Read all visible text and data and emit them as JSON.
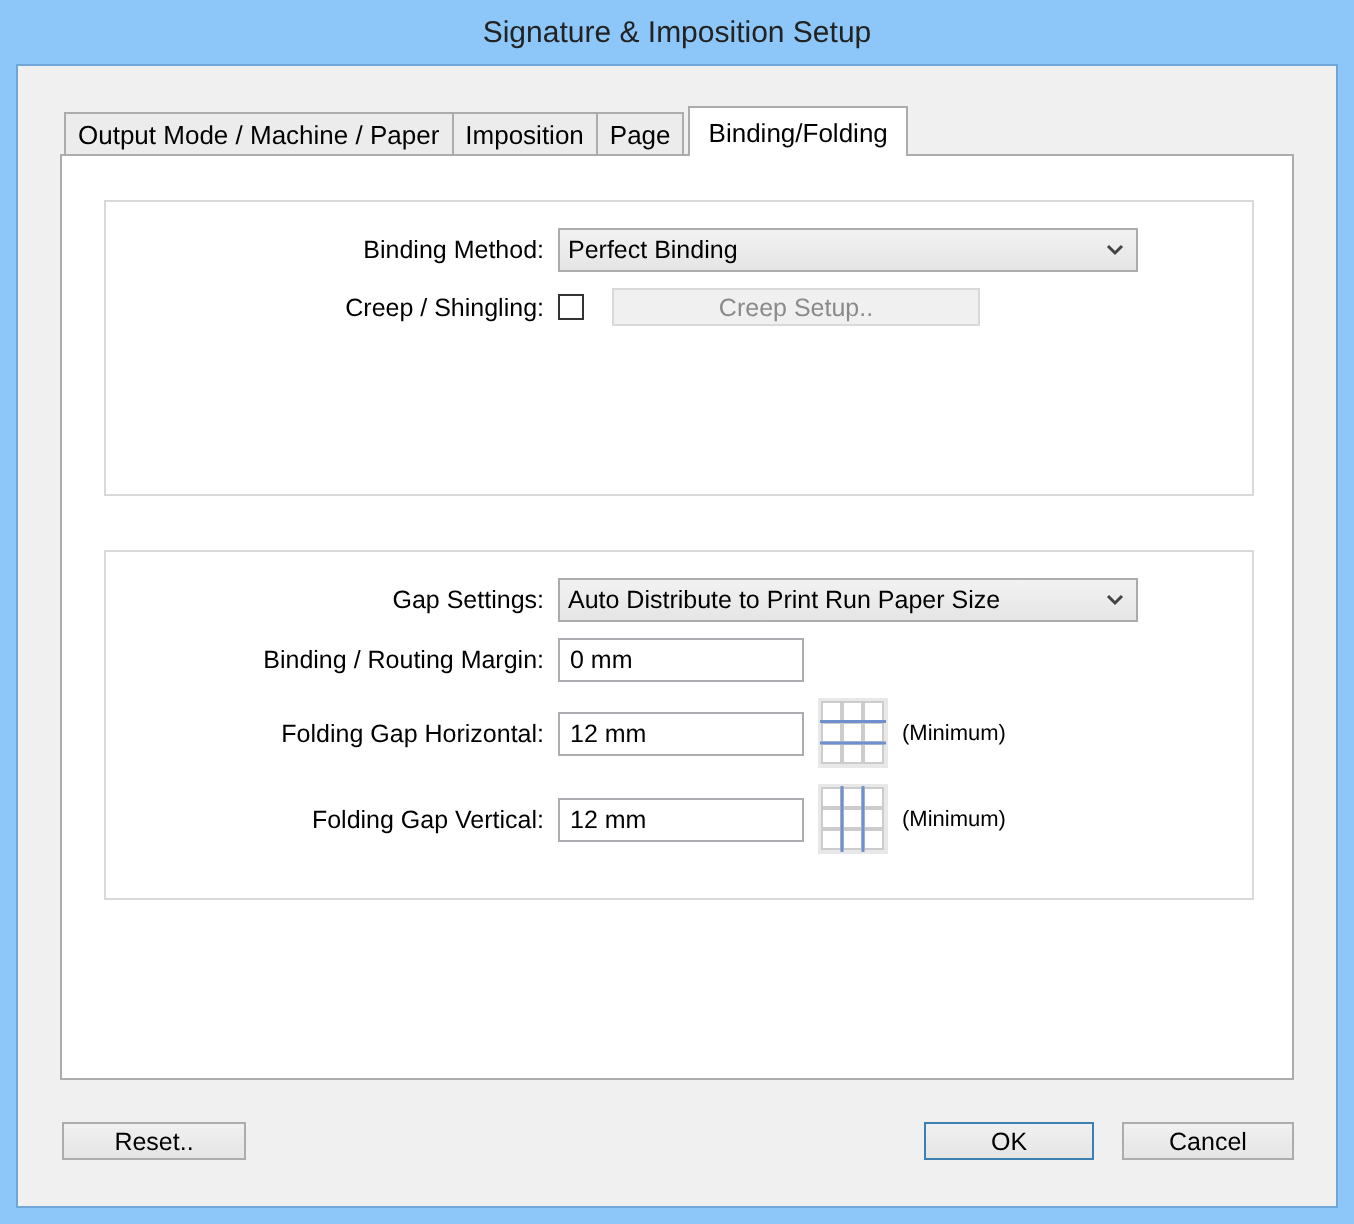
{
  "window": {
    "title": "Signature & Imposition Setup"
  },
  "tabs": [
    {
      "label": "Output Mode / Machine / Paper",
      "selected": false
    },
    {
      "label": "Imposition",
      "selected": false
    },
    {
      "label": "Page",
      "selected": false
    },
    {
      "label": "Binding/Folding",
      "selected": true
    }
  ],
  "binding": {
    "method_label": "Binding Method:",
    "method_value": "Perfect Binding",
    "creep_label": "Creep / Shingling:",
    "creep_checked": false,
    "creep_button": {
      "label": "Creep Setup..",
      "disabled": true
    }
  },
  "gap": {
    "label": "Gap Settings:",
    "value": "Auto Distribute to Print Run Paper Size",
    "fields": [
      {
        "label": "Binding / Routing Margin:",
        "value": "0 mm",
        "kind": "plain"
      },
      {
        "label": "Folding Gap Horizontal:",
        "value": "12 mm",
        "kind": "horizontal",
        "note": "(Minimum)"
      },
      {
        "label": "Folding Gap Vertical:",
        "value": "12 mm",
        "kind": "vertical",
        "note": "(Minimum)"
      }
    ]
  },
  "buttons": [
    {
      "label": "Reset..",
      "default": false
    },
    {
      "label": "OK",
      "default": true
    },
    {
      "label": "Cancel",
      "default": false
    }
  ]
}
